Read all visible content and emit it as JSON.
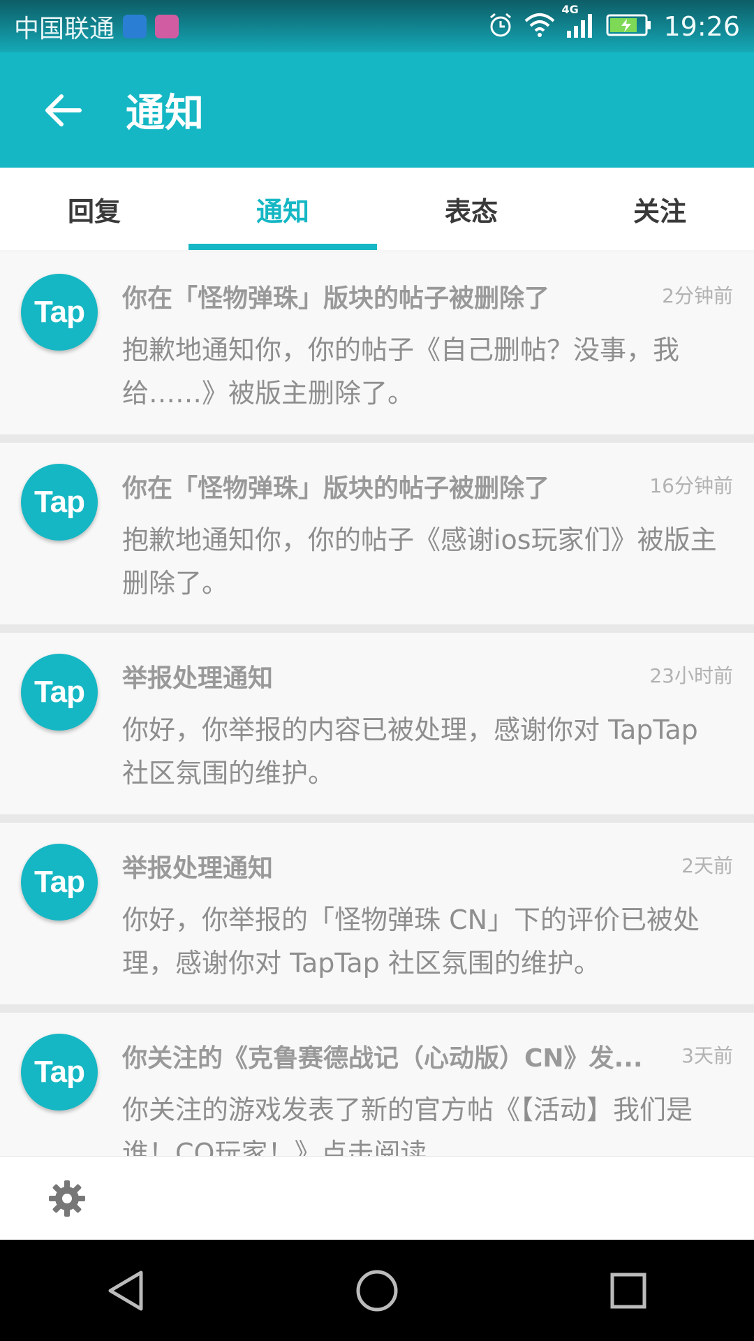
{
  "status_bar": {
    "carrier": "中国联通",
    "time": "19:26",
    "network": "4G"
  },
  "header": {
    "title": "通知"
  },
  "tabs": [
    {
      "label": "回复",
      "active": false
    },
    {
      "label": "通知",
      "active": true
    },
    {
      "label": "表态",
      "active": false
    },
    {
      "label": "关注",
      "active": false
    }
  ],
  "notifications": [
    {
      "avatar_text": "Tap",
      "title": "你在「怪物弹珠」版块的帖子被删除了",
      "time": "2分钟前",
      "body": "抱歉地通知你，你的帖子《自己删帖？没事，我给……》被版主删除了。"
    },
    {
      "avatar_text": "Tap",
      "title": "你在「怪物弹珠」版块的帖子被删除了",
      "time": "16分钟前",
      "body": "抱歉地通知你，你的帖子《感谢ios玩家们》被版主删除了。"
    },
    {
      "avatar_text": "Tap",
      "title": "举报处理通知",
      "time": "23小时前",
      "body": "你好，你举报的内容已被处理，感谢你对 TapTap 社区氛围的维护。"
    },
    {
      "avatar_text": "Tap",
      "title": "举报处理通知",
      "time": "2天前",
      "body": "你好，你举报的「怪物弹珠 CN」下的评价已被处理，感谢你对 TapTap 社区氛围的维护。"
    },
    {
      "avatar_text": "Tap",
      "title": "你关注的《克鲁赛德战记（心动版）CN》发...",
      "time": "3天前",
      "body": "你关注的游戏发表了新的官方帖《【活动】我们是谁！CQ玩家！》点击阅读"
    }
  ],
  "colors": {
    "accent": "#15b7c4",
    "header": "#15b7c4"
  }
}
